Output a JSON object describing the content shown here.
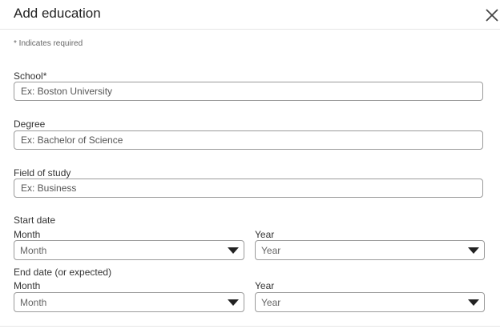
{
  "dialog": {
    "title": "Add education",
    "close_icon": "close-icon"
  },
  "required_note": "* Indicates required",
  "fields": {
    "school": {
      "label": "School*",
      "placeholder": "Ex: Boston University",
      "value": ""
    },
    "degree": {
      "label": "Degree",
      "placeholder": "Ex: Bachelor of Science",
      "value": ""
    },
    "field_of_study": {
      "label": "Field of study",
      "placeholder": "Ex: Business",
      "value": ""
    }
  },
  "start_date": {
    "label": "Start date",
    "month": {
      "label": "Month",
      "selected": "Month"
    },
    "year": {
      "label": "Year",
      "selected": "Year"
    }
  },
  "end_date": {
    "label": "End date (or expected)",
    "month": {
      "label": "Month",
      "selected": "Month"
    },
    "year": {
      "label": "Year",
      "selected": "Year"
    }
  },
  "icons": {
    "dropdown": "chevron-down-icon"
  }
}
